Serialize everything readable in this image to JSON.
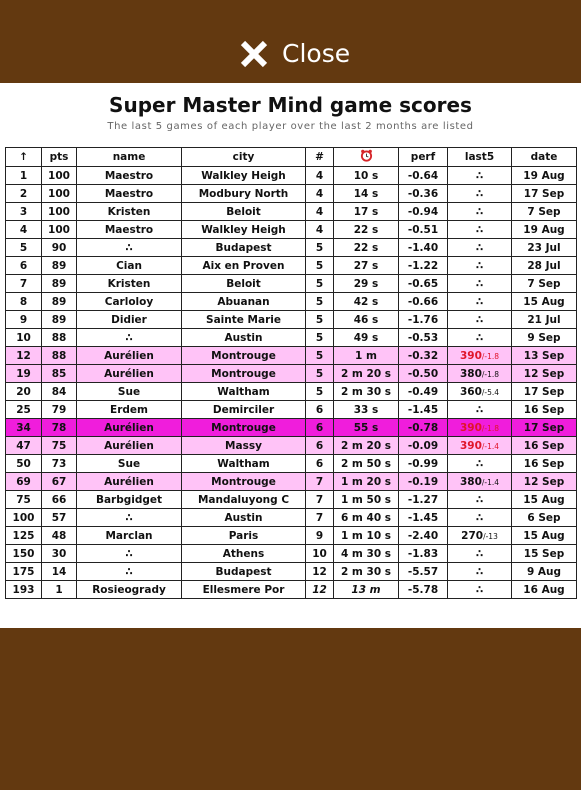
{
  "header": {
    "close_label": "Close",
    "close_icon": "x-mark-icon",
    "bar_color": "#633910"
  },
  "title": "Super Master Mind game scores",
  "subtitle": "The last 5 games of each player over the last 2 months are listed",
  "table": {
    "columns": [
      "↑",
      "pts",
      "name",
      "city",
      "#",
      "time-icon",
      "perf",
      "last5",
      "date"
    ],
    "highlight_colors": {
      "light": "#ffc3f7",
      "strong": "#f01ddc",
      "last5_red": "#e0142a"
    },
    "rows": [
      {
        "rank": "1",
        "pts": "100",
        "name": "Maestro",
        "city": "Walkley Heigh",
        "moves": "4",
        "time": "10 s",
        "perf": "-0.64",
        "l5": "∴",
        "l5sub": "",
        "date": "19 Aug",
        "hl": ""
      },
      {
        "rank": "2",
        "pts": "100",
        "name": "Maestro",
        "city": "Modbury North",
        "moves": "4",
        "time": "14 s",
        "perf": "-0.36",
        "l5": "∴",
        "l5sub": "",
        "date": "17 Sep",
        "hl": ""
      },
      {
        "rank": "3",
        "pts": "100",
        "name": "Kristen",
        "city": "Beloit",
        "moves": "4",
        "time": "17 s",
        "perf": "-0.94",
        "l5": "∴",
        "l5sub": "",
        "date": "7 Sep",
        "hl": ""
      },
      {
        "rank": "4",
        "pts": "100",
        "name": "Maestro",
        "city": "Walkley Heigh",
        "moves": "4",
        "time": "22 s",
        "perf": "-0.51",
        "l5": "∴",
        "l5sub": "",
        "date": "19 Aug",
        "hl": ""
      },
      {
        "rank": "5",
        "pts": "90",
        "name": "∴",
        "city": "Budapest",
        "moves": "5",
        "time": "22 s",
        "perf": "-1.40",
        "l5": "∴",
        "l5sub": "",
        "date": "23 Jul",
        "hl": ""
      },
      {
        "rank": "6",
        "pts": "89",
        "name": "Cian",
        "city": "Aix en Proven",
        "moves": "5",
        "time": "27 s",
        "perf": "-1.22",
        "l5": "∴",
        "l5sub": "",
        "date": "28 Jul",
        "hl": ""
      },
      {
        "rank": "7",
        "pts": "89",
        "name": "Kristen",
        "city": "Beloit",
        "moves": "5",
        "time": "29 s",
        "perf": "-0.65",
        "l5": "∴",
        "l5sub": "",
        "date": "7 Sep",
        "hl": ""
      },
      {
        "rank": "8",
        "pts": "89",
        "name": "Carloloy",
        "city": "Abuanan",
        "moves": "5",
        "time": "42 s",
        "perf": "-0.66",
        "l5": "∴",
        "l5sub": "",
        "date": "15 Aug",
        "hl": ""
      },
      {
        "rank": "9",
        "pts": "89",
        "name": "Didier",
        "city": "Sainte Marie",
        "moves": "5",
        "time": "46 s",
        "perf": "-1.76",
        "l5": "∴",
        "l5sub": "",
        "date": "21 Jul",
        "hl": ""
      },
      {
        "rank": "10",
        "pts": "88",
        "name": "∴",
        "city": "Austin",
        "moves": "5",
        "time": "49 s",
        "perf": "-0.53",
        "l5": "∴",
        "l5sub": "",
        "date": "9 Sep",
        "hl": ""
      },
      {
        "rank": "12",
        "pts": "88",
        "name": "Aurélien",
        "city": "Montrouge",
        "moves": "5",
        "time": "1 m",
        "perf": "-0.32",
        "l5": "390",
        "l5sub": "/-1.8",
        "l5red": true,
        "date": "13 Sep",
        "hl": "light"
      },
      {
        "rank": "19",
        "pts": "85",
        "name": "Aurélien",
        "city": "Montrouge",
        "moves": "5",
        "time": "2 m 20 s",
        "perf": "-0.50",
        "l5": "380",
        "l5sub": "/-1.8",
        "l5red": false,
        "date": "12 Sep",
        "hl": "light"
      },
      {
        "rank": "20",
        "pts": "84",
        "name": "Sue",
        "city": "Waltham",
        "moves": "5",
        "time": "2 m 30 s",
        "perf": "-0.49",
        "l5": "360",
        "l5sub": "/-5.4",
        "l5red": false,
        "date": "17 Sep",
        "hl": ""
      },
      {
        "rank": "25",
        "pts": "79",
        "name": "Erdem",
        "city": "Demirciler",
        "moves": "6",
        "time": "33 s",
        "perf": "-1.45",
        "l5": "∴",
        "l5sub": "",
        "date": "16 Sep",
        "hl": ""
      },
      {
        "rank": "34",
        "pts": "78",
        "name": "Aurélien",
        "city": "Montrouge",
        "moves": "6",
        "time": "55 s",
        "perf": "-0.78",
        "l5": "390",
        "l5sub": "/-1.8",
        "l5red": true,
        "date": "17 Sep",
        "hl": "strong"
      },
      {
        "rank": "47",
        "pts": "75",
        "name": "Aurélien",
        "city": "Massy",
        "moves": "6",
        "time": "2 m 20 s",
        "perf": "-0.09",
        "l5": "390",
        "l5sub": "/-1.4",
        "l5red": true,
        "date": "16 Sep",
        "hl": "light"
      },
      {
        "rank": "50",
        "pts": "73",
        "name": "Sue",
        "city": "Waltham",
        "moves": "6",
        "time": "2 m 50 s",
        "perf": "-0.99",
        "l5": "∴",
        "l5sub": "",
        "date": "16 Sep",
        "hl": ""
      },
      {
        "rank": "69",
        "pts": "67",
        "name": "Aurélien",
        "city": "Montrouge",
        "moves": "7",
        "time": "1 m 20 s",
        "perf": "-0.19",
        "l5": "380",
        "l5sub": "/-1.4",
        "l5red": false,
        "date": "12 Sep",
        "hl": "light"
      },
      {
        "rank": "75",
        "pts": "66",
        "name": "Barbgidget",
        "city": "Mandaluyong C",
        "moves": "7",
        "time": "1 m 50 s",
        "perf": "-1.27",
        "l5": "∴",
        "l5sub": "",
        "date": "15 Aug",
        "hl": ""
      },
      {
        "rank": "100",
        "pts": "57",
        "name": "∴",
        "city": "Austin",
        "moves": "7",
        "time": "6 m 40 s",
        "perf": "-1.45",
        "l5": "∴",
        "l5sub": "",
        "date": "6 Sep",
        "hl": ""
      },
      {
        "rank": "125",
        "pts": "48",
        "name": "Marclan",
        "city": "Paris",
        "moves": "9",
        "time": "1 m 10 s",
        "perf": "-2.40",
        "l5": "270",
        "l5sub": "/-13",
        "l5red": false,
        "date": "15 Aug",
        "hl": ""
      },
      {
        "rank": "150",
        "pts": "30",
        "name": "∴",
        "city": "Athens",
        "moves": "10",
        "time": "4 m 30 s",
        "perf": "-1.83",
        "l5": "∴",
        "l5sub": "",
        "date": "15 Sep",
        "hl": ""
      },
      {
        "rank": "175",
        "pts": "14",
        "name": "∴",
        "city": "Budapest",
        "moves": "12",
        "time": "2 m 30 s",
        "perf": "-5.57",
        "l5": "∴",
        "l5sub": "",
        "date": "9 Aug",
        "hl": ""
      },
      {
        "rank": "193",
        "pts": "1",
        "name": "Rosieogrady",
        "city": "Ellesmere Por",
        "moves": "12",
        "time": "13 m",
        "perf": "-5.78",
        "l5": "∴",
        "l5sub": "",
        "date": "16 Aug",
        "hl": "",
        "italic": true
      }
    ]
  }
}
